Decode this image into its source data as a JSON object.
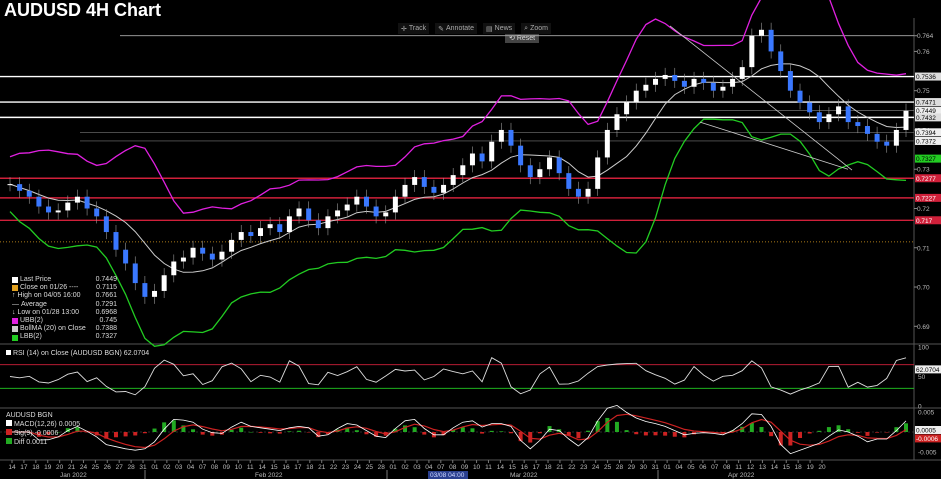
{
  "title": "AUDUSD 4H Chart",
  "toolbar": {
    "track": "Track",
    "annotate": "Annotate",
    "news": "News",
    "zoom": "Zoom",
    "reset": "Reset"
  },
  "colors": {
    "background": "#000000",
    "upper_band": "#e020e0",
    "lower_band": "#22cc22",
    "moving_avg": "#cccccc",
    "support_line": "#d0203a",
    "resistance_line": "#ffffff",
    "average_line": "#e0a020",
    "rsi_line": "#dddddd",
    "macd_pos": "#22aa22",
    "macd_neg": "#cc2222"
  },
  "legend": {
    "items": [
      {
        "label": "Last Price",
        "value": "0.7449",
        "swatch": "#ffffff"
      },
      {
        "label": "Close on 01/26 ----",
        "value": "0.7115",
        "swatch": "#e0a020"
      },
      {
        "label": "High on 04/05 16:00",
        "value": "0.7661",
        "swatch": "#888888"
      },
      {
        "label": "Average",
        "value": "0.7291",
        "swatch": "#888888"
      },
      {
        "label": "Low on 01/28 13:00",
        "value": "0.6968",
        "swatch": "#888888"
      },
      {
        "label": "UBB(2)",
        "value": "0.745",
        "swatch": "#e020e0"
      },
      {
        "label": "BollMA (20)  on Close",
        "value": "0.7388",
        "swatch": "#cccccc"
      },
      {
        "label": "LBB(2)",
        "value": "0.7327",
        "swatch": "#22cc22"
      }
    ]
  },
  "rsi": {
    "label": "RSI (14)  on Close (AUDUSD BGN)  62.0704",
    "value_tag": "62.0704"
  },
  "macd": {
    "title": "AUDUSD BGN",
    "items": [
      {
        "label": "MACD(12,26)",
        "value": "0.0005",
        "swatch": "#ffffff"
      },
      {
        "label": "Sig(9)",
        "value": "-0.0006",
        "swatch": "#cc2222"
      },
      {
        "label": "Diff",
        "value": "0.0011",
        "swatch": "#22aa22"
      }
    ],
    "value_tag_1": "0.0005",
    "value_tag_2": "-0.0006"
  },
  "chart_data": {
    "type": "line",
    "title": "AUDUSD 4H Chart",
    "price_axis_ticks": [
      "0.764",
      "0.76",
      "0.75",
      "0.74",
      "0.73",
      "0.72",
      "0.71",
      "0.70",
      "0.69"
    ],
    "price_levels": [
      {
        "label": "0.7536",
        "value": 0.7536,
        "kind": "resistance"
      },
      {
        "label": "0.7471",
        "value": 0.7471,
        "kind": "resistance"
      },
      {
        "label": "0.7449",
        "value": 0.7449,
        "kind": "last"
      },
      {
        "label": "0.7432",
        "value": 0.7432,
        "kind": "resistance"
      },
      {
        "label": "0.7394",
        "value": 0.7394,
        "kind": "band"
      },
      {
        "label": "0.7372",
        "value": 0.7372,
        "kind": "band"
      },
      {
        "label": "0.7327",
        "value": 0.7327,
        "kind": "lower_band"
      },
      {
        "label": "0.7277",
        "value": 0.7277,
        "kind": "support"
      },
      {
        "label": "0.7227",
        "value": 0.7227,
        "kind": "support"
      },
      {
        "label": "0.717",
        "value": 0.717,
        "kind": "support"
      }
    ],
    "top_line": {
      "label": "0.764",
      "value": 0.764
    },
    "average_line": 0.7115,
    "ylim": [
      0.686,
      0.768
    ],
    "rsi_axis_ticks": [
      "100",
      "50",
      "0"
    ],
    "macd_axis_ticks": [
      "0.005",
      "-0.005"
    ],
    "x_tick_labels": [
      "14",
      "17",
      "18",
      "19",
      "20",
      "21",
      "24",
      "25",
      "26",
      "27",
      "28",
      "31",
      "01",
      "02",
      "03",
      "04",
      "07",
      "08",
      "09",
      "10",
      "11",
      "14",
      "15",
      "16",
      "17",
      "18",
      "21",
      "22",
      "23",
      "24",
      "25",
      "28",
      "01",
      "02",
      "03",
      "04",
      "07",
      "08",
      "09",
      "10",
      "11",
      "14",
      "15",
      "16",
      "17",
      "18",
      "21",
      "22",
      "23",
      "24",
      "25",
      "28",
      "29",
      "30",
      "31",
      "01",
      "04",
      "05",
      "06",
      "07",
      "08",
      "11",
      "12",
      "13",
      "14",
      "15",
      "18",
      "19",
      "20"
    ],
    "month_labels": [
      "Jan 2022",
      "Feb 2022",
      "Mar 2022",
      "Apr 2022"
    ],
    "cursor_label": "03/08 04:00",
    "close": [
      0.7262,
      0.7245,
      0.723,
      0.7205,
      0.719,
      0.7195,
      0.7215,
      0.723,
      0.72,
      0.718,
      0.714,
      0.7095,
      0.706,
      0.701,
      0.6975,
      0.699,
      0.703,
      0.7065,
      0.7075,
      0.71,
      0.7085,
      0.707,
      0.709,
      0.712,
      0.714,
      0.713,
      0.715,
      0.716,
      0.714,
      0.718,
      0.72,
      0.717,
      0.715,
      0.718,
      0.7195,
      0.721,
      0.723,
      0.7205,
      0.718,
      0.719,
      0.723,
      0.726,
      0.728,
      0.7255,
      0.724,
      0.726,
      0.7285,
      0.731,
      0.734,
      0.732,
      0.737,
      0.74,
      0.736,
      0.731,
      0.728,
      0.73,
      0.733,
      0.729,
      0.725,
      0.723,
      0.725,
      0.733,
      0.74,
      0.744,
      0.747,
      0.75,
      0.7515,
      0.753,
      0.754,
      0.7525,
      0.751,
      0.753,
      0.752,
      0.75,
      0.751,
      0.753,
      0.756,
      0.764,
      0.7655,
      0.76,
      0.755,
      0.75,
      0.747,
      0.7445,
      0.742,
      0.744,
      0.746,
      0.742,
      0.741,
      0.739,
      0.737,
      0.736,
      0.74,
      0.7449
    ]
  }
}
